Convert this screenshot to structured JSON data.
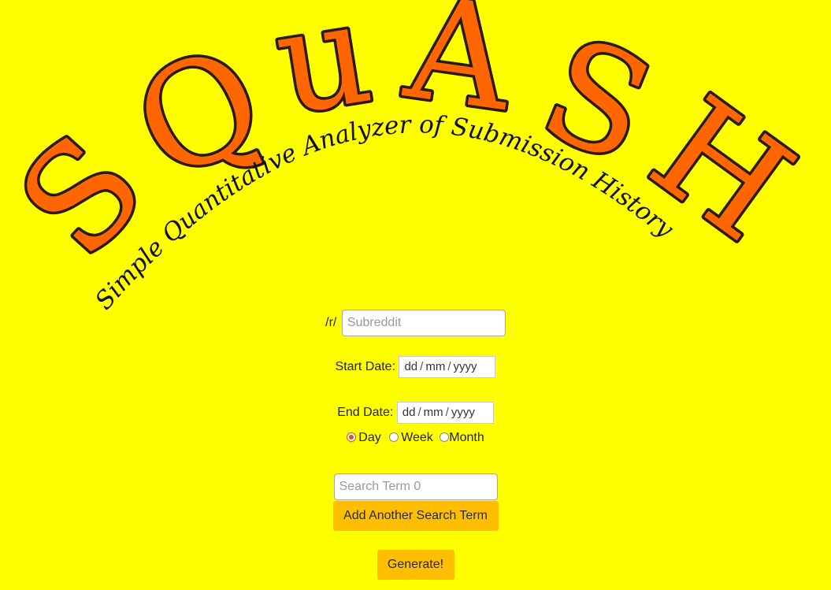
{
  "logo": {
    "title": "SQuASH",
    "letters": [
      "S",
      "Q",
      "u",
      "A",
      "S",
      "H"
    ],
    "subtitle": "Simple Quantitative Analyzer of Submission History"
  },
  "colors": {
    "background": "#ffff00",
    "logo_fill": "#ff6600",
    "logo_outline": "#2a1a0a",
    "button": "#ffbf00",
    "radio_checked": "#d2541b"
  },
  "form": {
    "subreddit_prefix": "/r/",
    "subreddit_placeholder": "Subreddit",
    "start_date_label": "Start Date:",
    "end_date_label": "End Date:",
    "date_placeholder": {
      "day": "dd",
      "month": "mm",
      "year": "yyyy",
      "separator": "/"
    },
    "interval_options": [
      {
        "label": "Day",
        "checked": true
      },
      {
        "label": "Week",
        "checked": false
      },
      {
        "label": "Month",
        "checked": false
      }
    ],
    "search_term_placeholder": "Search Term 0",
    "add_term_button": "Add Another Search Term",
    "generate_button": "Generate!"
  }
}
